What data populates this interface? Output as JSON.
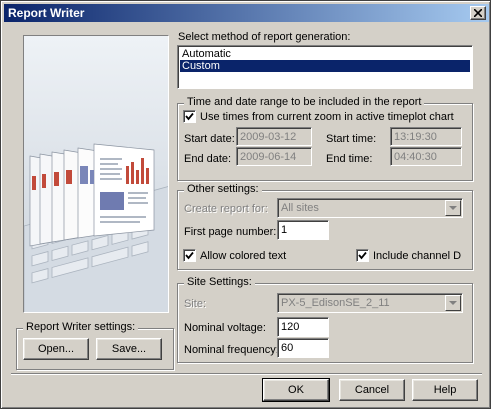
{
  "window": {
    "title": "Report Writer"
  },
  "method": {
    "label": "Select method of report generation:",
    "options": [
      "Automatic",
      "Custom"
    ],
    "selected": "Custom"
  },
  "time_range": {
    "legend": "Time and date range to be included in the report",
    "use_zoom_label": "Use times from current zoom in active timeplot chart",
    "use_zoom_checked": true,
    "start_date_label": "Start date:",
    "start_date": "2009-03-12",
    "end_date_label": "End date:",
    "end_date": "2009-06-14",
    "start_time_label": "Start time:",
    "start_time": "13:19:30",
    "end_time_label": "End time:",
    "end_time": "04:40:30"
  },
  "other": {
    "legend": "Other settings:",
    "create_for_label": "Create report for:",
    "create_for_value": "All sites",
    "first_page_label": "First page number:",
    "first_page_value": "1",
    "colored_text_label": "Allow colored text",
    "colored_text_checked": true,
    "channel_d_label": "Include channel D",
    "channel_d_checked": true
  },
  "site": {
    "legend": "Site Settings:",
    "site_label": "Site:",
    "site_value": "PX-5_EdisonSE_2_11",
    "voltage_label": "Nominal voltage:",
    "voltage_value": "120",
    "frequency_label": "Nominal frequency:",
    "frequency_value": "60"
  },
  "writer_settings": {
    "legend": "Report Writer settings:",
    "open_label": "Open...",
    "save_label": "Save..."
  },
  "footer": {
    "ok_label": "OK",
    "cancel_label": "Cancel",
    "help_label": "Help"
  },
  "icons": {
    "close": "close-icon",
    "check": "checkmark-icon",
    "dropdown": "chevron-down-icon"
  },
  "colors": {
    "title_start": "#0a246a",
    "title_end": "#a6caf0",
    "selection": "#0a246a",
    "face": "#d4d0c8"
  }
}
